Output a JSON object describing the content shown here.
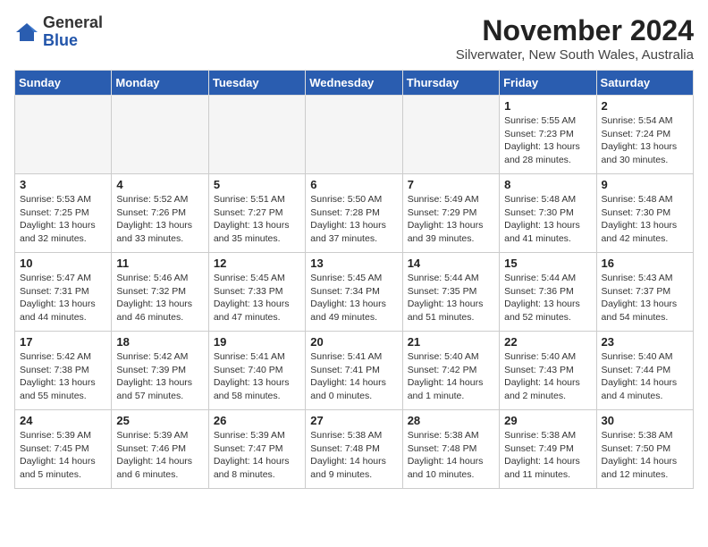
{
  "logo": {
    "general": "General",
    "blue": "Blue"
  },
  "title": "November 2024",
  "subtitle": "Silverwater, New South Wales, Australia",
  "days_header": [
    "Sunday",
    "Monday",
    "Tuesday",
    "Wednesday",
    "Thursday",
    "Friday",
    "Saturday"
  ],
  "weeks": [
    [
      {
        "day": "",
        "detail": "",
        "empty": true
      },
      {
        "day": "",
        "detail": "",
        "empty": true
      },
      {
        "day": "",
        "detail": "",
        "empty": true
      },
      {
        "day": "",
        "detail": "",
        "empty": true
      },
      {
        "day": "",
        "detail": "",
        "empty": true
      },
      {
        "day": "1",
        "detail": "Sunrise: 5:55 AM\nSunset: 7:23 PM\nDaylight: 13 hours\nand 28 minutes."
      },
      {
        "day": "2",
        "detail": "Sunrise: 5:54 AM\nSunset: 7:24 PM\nDaylight: 13 hours\nand 30 minutes."
      }
    ],
    [
      {
        "day": "3",
        "detail": "Sunrise: 5:53 AM\nSunset: 7:25 PM\nDaylight: 13 hours\nand 32 minutes."
      },
      {
        "day": "4",
        "detail": "Sunrise: 5:52 AM\nSunset: 7:26 PM\nDaylight: 13 hours\nand 33 minutes."
      },
      {
        "day": "5",
        "detail": "Sunrise: 5:51 AM\nSunset: 7:27 PM\nDaylight: 13 hours\nand 35 minutes."
      },
      {
        "day": "6",
        "detail": "Sunrise: 5:50 AM\nSunset: 7:28 PM\nDaylight: 13 hours\nand 37 minutes."
      },
      {
        "day": "7",
        "detail": "Sunrise: 5:49 AM\nSunset: 7:29 PM\nDaylight: 13 hours\nand 39 minutes."
      },
      {
        "day": "8",
        "detail": "Sunrise: 5:48 AM\nSunset: 7:30 PM\nDaylight: 13 hours\nand 41 minutes."
      },
      {
        "day": "9",
        "detail": "Sunrise: 5:48 AM\nSunset: 7:30 PM\nDaylight: 13 hours\nand 42 minutes."
      }
    ],
    [
      {
        "day": "10",
        "detail": "Sunrise: 5:47 AM\nSunset: 7:31 PM\nDaylight: 13 hours\nand 44 minutes."
      },
      {
        "day": "11",
        "detail": "Sunrise: 5:46 AM\nSunset: 7:32 PM\nDaylight: 13 hours\nand 46 minutes."
      },
      {
        "day": "12",
        "detail": "Sunrise: 5:45 AM\nSunset: 7:33 PM\nDaylight: 13 hours\nand 47 minutes."
      },
      {
        "day": "13",
        "detail": "Sunrise: 5:45 AM\nSunset: 7:34 PM\nDaylight: 13 hours\nand 49 minutes."
      },
      {
        "day": "14",
        "detail": "Sunrise: 5:44 AM\nSunset: 7:35 PM\nDaylight: 13 hours\nand 51 minutes."
      },
      {
        "day": "15",
        "detail": "Sunrise: 5:44 AM\nSunset: 7:36 PM\nDaylight: 13 hours\nand 52 minutes."
      },
      {
        "day": "16",
        "detail": "Sunrise: 5:43 AM\nSunset: 7:37 PM\nDaylight: 13 hours\nand 54 minutes."
      }
    ],
    [
      {
        "day": "17",
        "detail": "Sunrise: 5:42 AM\nSunset: 7:38 PM\nDaylight: 13 hours\nand 55 minutes."
      },
      {
        "day": "18",
        "detail": "Sunrise: 5:42 AM\nSunset: 7:39 PM\nDaylight: 13 hours\nand 57 minutes."
      },
      {
        "day": "19",
        "detail": "Sunrise: 5:41 AM\nSunset: 7:40 PM\nDaylight: 13 hours\nand 58 minutes."
      },
      {
        "day": "20",
        "detail": "Sunrise: 5:41 AM\nSunset: 7:41 PM\nDaylight: 14 hours\nand 0 minutes."
      },
      {
        "day": "21",
        "detail": "Sunrise: 5:40 AM\nSunset: 7:42 PM\nDaylight: 14 hours\nand 1 minute."
      },
      {
        "day": "22",
        "detail": "Sunrise: 5:40 AM\nSunset: 7:43 PM\nDaylight: 14 hours\nand 2 minutes."
      },
      {
        "day": "23",
        "detail": "Sunrise: 5:40 AM\nSunset: 7:44 PM\nDaylight: 14 hours\nand 4 minutes."
      }
    ],
    [
      {
        "day": "24",
        "detail": "Sunrise: 5:39 AM\nSunset: 7:45 PM\nDaylight: 14 hours\nand 5 minutes."
      },
      {
        "day": "25",
        "detail": "Sunrise: 5:39 AM\nSunset: 7:46 PM\nDaylight: 14 hours\nand 6 minutes."
      },
      {
        "day": "26",
        "detail": "Sunrise: 5:39 AM\nSunset: 7:47 PM\nDaylight: 14 hours\nand 8 minutes."
      },
      {
        "day": "27",
        "detail": "Sunrise: 5:38 AM\nSunset: 7:48 PM\nDaylight: 14 hours\nand 9 minutes."
      },
      {
        "day": "28",
        "detail": "Sunrise: 5:38 AM\nSunset: 7:48 PM\nDaylight: 14 hours\nand 10 minutes."
      },
      {
        "day": "29",
        "detail": "Sunrise: 5:38 AM\nSunset: 7:49 PM\nDaylight: 14 hours\nand 11 minutes."
      },
      {
        "day": "30",
        "detail": "Sunrise: 5:38 AM\nSunset: 7:50 PM\nDaylight: 14 hours\nand 12 minutes."
      }
    ]
  ]
}
